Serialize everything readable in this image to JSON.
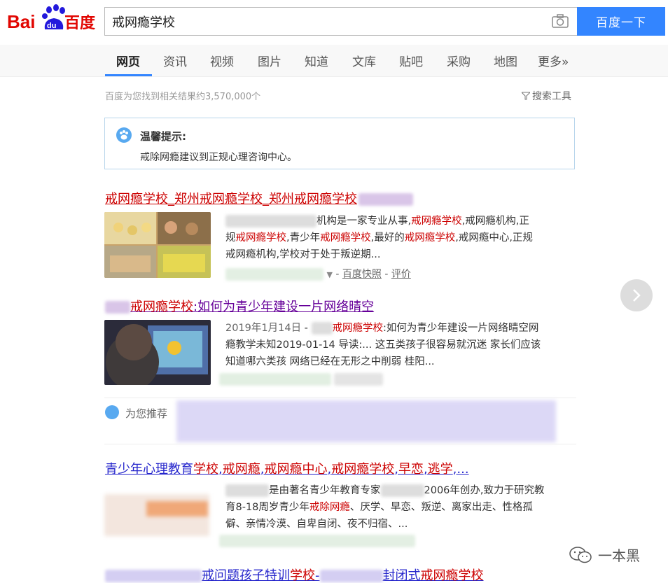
{
  "search": {
    "query": "戒网瘾学校",
    "button_label": "百度一下"
  },
  "logo": {
    "text_bai": "Bai",
    "text_du": "du",
    "text_cn": "百度"
  },
  "tabs": [
    {
      "label": "网页",
      "active": true
    },
    {
      "label": "资讯"
    },
    {
      "label": "视频"
    },
    {
      "label": "图片"
    },
    {
      "label": "知道"
    },
    {
      "label": "文库"
    },
    {
      "label": "贴吧"
    },
    {
      "label": "采购"
    },
    {
      "label": "地图"
    },
    {
      "label": "更多»"
    }
  ],
  "stats": "百度为您找到相关结果约3,570,000个",
  "tools_label": "搜索工具",
  "tip": {
    "title": "温馨提示:",
    "text": "戒除网瘾建议到正规心理咨询中心。"
  },
  "results": [
    {
      "title_parts": [
        "戒网瘾学校",
        "_郑州",
        "戒网瘾学校",
        "_郑州",
        "戒网瘾学校"
      ],
      "abstract_1_a": "机构是一家专业从事,",
      "abstract_1_hl": "戒网瘾学校",
      "abstract_1_b": ",戒网瘾机构,正",
      "abstract_2_a": "规",
      "abstract_2_hl1": "戒网瘾学校",
      "abstract_2_b": ",青少年",
      "abstract_2_hl2": "戒网瘾学校",
      "abstract_2_c": ",最好的",
      "abstract_2_hl3": "戒网瘾学校",
      "abstract_2_d": ",戒网瘾中心,正规",
      "abstract_3": "戒网瘾机构,学校对于处于叛逆期...",
      "snapshot": "百度快照",
      "review": "评价"
    },
    {
      "title_hl": "戒网瘾学校",
      "title_rest": ":如何为青少年建设一片网络晴空",
      "date": "2019年1月14日",
      "abs_hl": "戒网瘾学校",
      "abs_1": ":如何为青少年建设一片网络晴空网",
      "abs_2": "瘾教学未知2019-01-14 导读:... 这五类孩子很容易就沉迷 家长们应该",
      "abs_3": "知道哪六类孩 网络已经在无形之中削弱 桂阳..."
    },
    {
      "title_a": "青少年心理教育",
      "title_hl1": "学校",
      "title_b": ",",
      "title_hl2": "戒网瘾",
      "title_c": ",",
      "title_hl3": "戒网瘾中心",
      "title_d": ",",
      "title_hl4": "戒网瘾学校",
      "title_e": ",",
      "title_hl5": "早恋",
      "title_f": ",",
      "title_hl6": "逃学",
      "title_g": ",...",
      "abs_1a": "是由著名青少年教育专家",
      "abs_1b": "2006年创办,致力于研究教",
      "abs_2a": "育8-18周岁青少年",
      "abs_2hl": "戒除网瘾",
      "abs_2b": "、厌学、早恋、叛逆、离家出走、性格孤",
      "abs_3": "僻、亲情冷漠、自卑自闭、夜不归宿、..."
    },
    {
      "title_a": "戒问题孩子特训",
      "title_hl1": "学校",
      "title_b": "-",
      "title_c": "封闭式",
      "title_hl2": "戒网瘾学校"
    }
  ],
  "recommend_label": "为您推荐",
  "watermark": "一本黑",
  "colors": {
    "accent": "#3385ff",
    "highlight": "#cc0000",
    "visited": "#660099",
    "link": "#2626cc",
    "logo_red": "#e10601"
  }
}
